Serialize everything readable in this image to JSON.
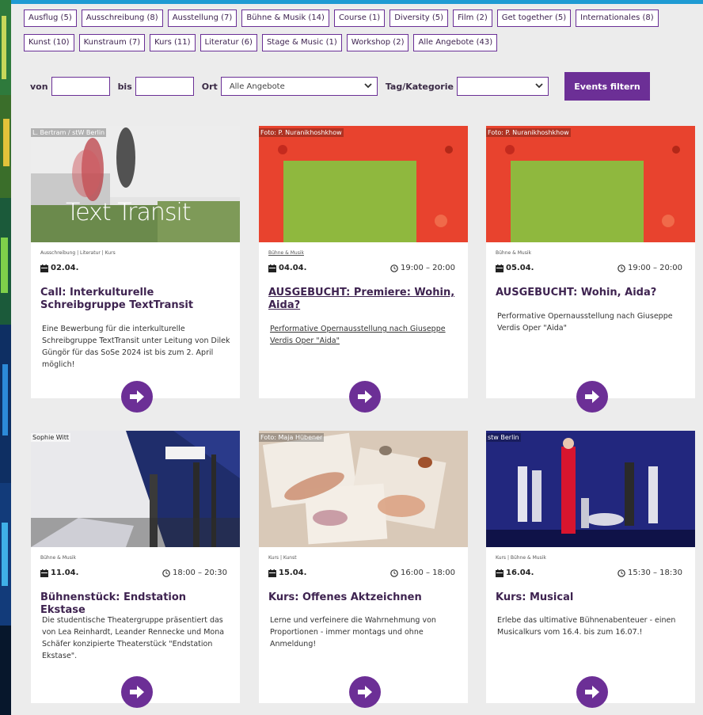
{
  "tags": [
    "Ausflug (5)",
    "Ausschreibung (8)",
    "Ausstellung (7)",
    "Bühne & Musik (14)",
    "Course (1)",
    "Diversity (5)",
    "Film (2)",
    "Get together (5)",
    "Internationales (8)",
    "Kunst (10)",
    "Kunstraum (7)",
    "Kurs (11)",
    "Literatur (6)",
    "Stage & Music (1)",
    "Workshop (2)",
    "Alle Angebote (43)"
  ],
  "filter": {
    "von_label": "von",
    "bis_label": "bis",
    "ort_label": "Ort",
    "ort_value": "Alle Angebote",
    "tag_label": "Tag/Kategorie",
    "tag_value": "",
    "submit_label": "Events filtern"
  },
  "events": [
    {
      "credit": "L. Bertram / stW Berlin",
      "category": "Ausschreibung | Literatur | Kurs",
      "date": "02.04.",
      "time": "",
      "title": "Call: Interkulturelle Schreibgruppe TextTransit",
      "description": "Eine Bewerbung für die interkulturelle Schreibgruppe TextTransit unter Leitung von Dilek Güngör für das SoSe 2024 ist bis zum 2. April möglich!",
      "image_text": "Text Transit"
    },
    {
      "credit": "Foto: P. Nuranikhoshkhow",
      "category": "Bühne & Musik",
      "date": "04.04.",
      "time": "19:00 – 20:00",
      "title": "AUSGEBUCHT: Premiere: Wohin, Aida?",
      "description": "Performative Opernausstellung nach Giuseppe Verdis Oper \"Aida\""
    },
    {
      "credit": "Foto: P. Nuranikhoshkhow",
      "category": "Bühne & Musik",
      "date": "05.04.",
      "time": "19:00 – 20:00",
      "title": "AUSGEBUCHT: Wohin, Aida?",
      "description": "Performative Opernausstellung nach Giuseppe Verdis Oper \"Aida\""
    },
    {
      "credit": "Sophie Witt",
      "category": "Bühne & Musik",
      "date": "11.04.",
      "time": "18:00 – 20:30",
      "title": "Bühnenstück: Endstation Ekstase",
      "description": "Die studentische Theatergruppe präsentiert das von Lea Reinhardt, Leander Rennecke und Mona Schäfer konzipierte Theaterstück \"Endstation Ekstase\"."
    },
    {
      "credit": "Foto: Maja Hübener",
      "category": "Kurs | Kunst",
      "date": "15.04.",
      "time": "16:00 – 18:00",
      "title": "Kurs: Offenes Aktzeichnen",
      "description": "Lerne und verfeinere die Wahrnehmung von Proportionen - immer montags und ohne Anmeldung!"
    },
    {
      "credit": "stw Berlin",
      "category": "Kurs | Bühne & Musik",
      "date": "16.04.",
      "time": "15:30 – 18:30",
      "title": "Kurs: Musical",
      "description": "Erlebe das ultimative Bühnenabenteuer - einen Musicalkurs vom 16.4. bis zum 16.07.!"
    }
  ],
  "colors": {
    "accent": "#6c2f96",
    "title": "#3e2350",
    "page_bg": "#ececec",
    "top_strip": "#1f9bd3"
  },
  "icons": {
    "date": "calendar-icon",
    "time": "clock-icon",
    "arrow": "arrow-right-icon",
    "dropdown": "chevron-down-icon"
  }
}
